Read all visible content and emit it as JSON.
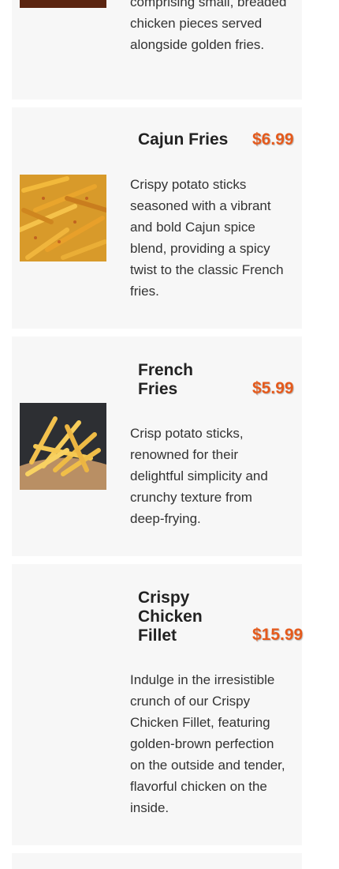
{
  "menu": {
    "items": [
      {
        "name": "",
        "price": "",
        "description": "comprising small, breaded chicken pieces served alongside golden fries.",
        "image_icon": "chicken-bites-photo"
      },
      {
        "name": "Cajun Fries",
        "price": "$6.99",
        "description": "Crispy potato sticks seasoned with a vibrant and bold Cajun spice blend, providing a spicy twist to the classic French fries.",
        "image_icon": "cajun-fries-photo"
      },
      {
        "name": "French Fries",
        "price": "$5.99",
        "description": "Crisp potato sticks, renowned for their delightful simplicity and crunchy texture from deep-frying.",
        "image_icon": "french-fries-photo"
      },
      {
        "name": "Crispy Chicken Fillet",
        "price": "$15.99",
        "description": "Indulge in the irresistible crunch of our Crispy Chicken Fillet, featuring golden-brown perfection on the outside and tender, flavorful chicken on the inside.",
        "image_icon": ""
      }
    ]
  },
  "colors": {
    "card_background": "#f7f7f7",
    "price": "#e55a1c",
    "title": "#222222",
    "text": "#333333"
  }
}
